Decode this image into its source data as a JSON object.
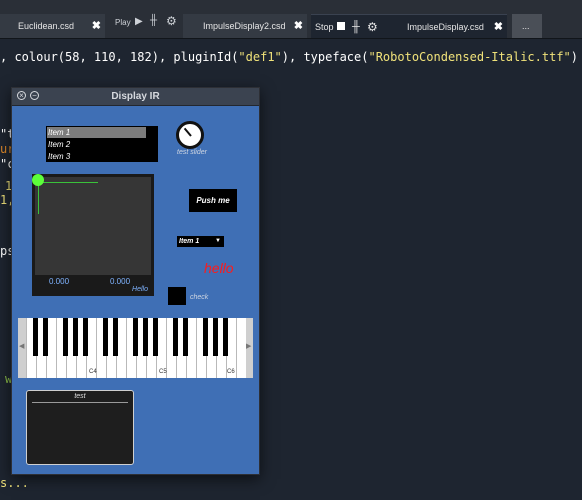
{
  "tabs": [
    {
      "label": "Euclidean.csd"
    },
    {
      "label": "ImpulseDisplay2.csd"
    },
    {
      "label": "ImpulseDisplay.csd"
    },
    {
      "label": "..."
    }
  ],
  "play_label": "Play",
  "stop_label": "Stop",
  "code": {
    "line1_prefix": ", colour(58, 110, 182), pluginId(",
    "line1_str1": "\"def1\"",
    "line1_mid": "), typeface(",
    "line1_str2": "\"RobotoCondensed-Italic.ttf\"",
    "line1_end": ")",
    "frag_t": "\"t",
    "frag_ur": "ur",
    "frag_c": "\"c",
    "frag_1": "1",
    "frag_1c": "1,",
    "frag_ps": "ps",
    "frag_w": "w",
    "frag_dots": "s..."
  },
  "window": {
    "title": "Display IR",
    "listbox": [
      "Item 1",
      "Item 2",
      "Item 3"
    ],
    "knob_label": "test slider",
    "xy_x": "0.000",
    "xy_y": "0.000",
    "xy_label": "Hello",
    "push_label": "Push me",
    "combo_value": "Item 1",
    "hello_label": "hello",
    "check_label": "check",
    "key_labels": [
      "C4",
      "C5",
      "C6"
    ],
    "textarea_label": "test"
  },
  "colors": {
    "panel": "#3f6fb5",
    "accent_green": "#5cff3a",
    "hello_red": "#ff1a1a"
  }
}
